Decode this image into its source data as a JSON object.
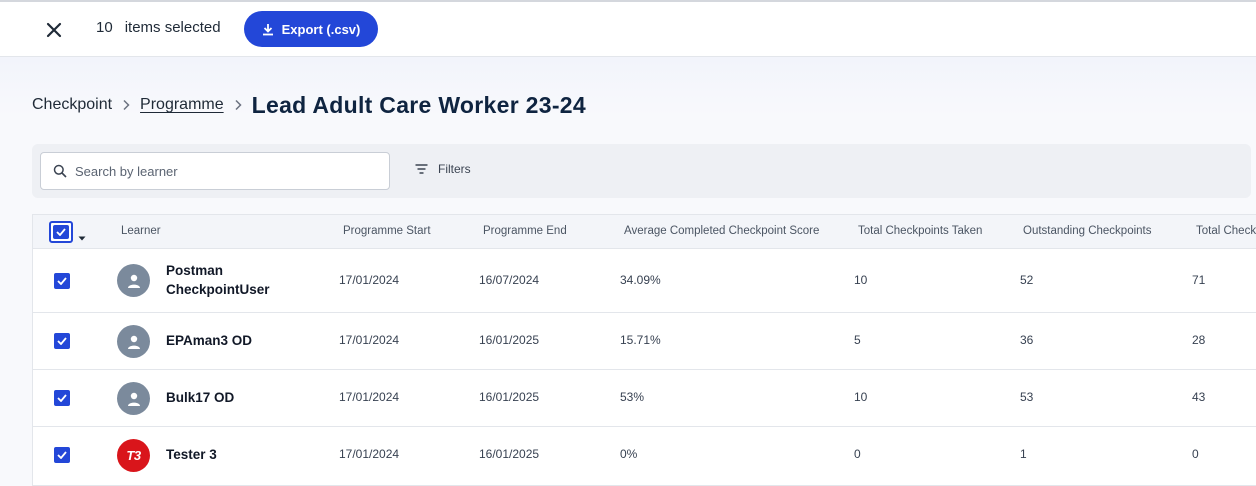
{
  "topbar": {
    "count": "10",
    "selected_label": "items selected",
    "export_label": "Export (.csv)"
  },
  "breadcrumb": {
    "root": "Checkpoint",
    "programme": "Programme",
    "title": "Lead Adult Care Worker 23-24"
  },
  "search": {
    "placeholder": "Search by learner",
    "value": ""
  },
  "filters": {
    "label": "Filters"
  },
  "table": {
    "columns": [
      "Learner",
      "Programme Start",
      "Programme End",
      "Average Completed Checkpoint Score",
      "Total Checkpoints Taken",
      "Outstanding Checkpoints",
      "Total Checkpoints"
    ],
    "rows": [
      {
        "name_line1": "Postman",
        "name_line2": "CheckpointUser",
        "start": "17/01/2024",
        "end": "16/07/2024",
        "avg": "34.09%",
        "taken": "10",
        "outstanding": "52",
        "total": "71",
        "avatar": "user-icon",
        "checked": true
      },
      {
        "name_line1": "EPAman3 OD",
        "name_line2": "",
        "start": "17/01/2024",
        "end": "16/01/2025",
        "avg": "15.71%",
        "taken": "5",
        "outstanding": "36",
        "total": "28",
        "avatar": "user-icon",
        "checked": true
      },
      {
        "name_line1": "Bulk17 OD",
        "name_line2": "",
        "start": "17/01/2024",
        "end": "16/01/2025",
        "avg": "53%",
        "taken": "10",
        "outstanding": "53",
        "total": "43",
        "avatar": "user-icon",
        "checked": true
      },
      {
        "name_line1": "Tester 3",
        "name_line2": "",
        "start": "17/01/2024",
        "end": "16/01/2025",
        "avg": "0%",
        "taken": "0",
        "outstanding": "1",
        "total": "0",
        "avatar": "T3",
        "checked": true
      }
    ]
  },
  "colors": {
    "accent": "#2347d8",
    "title": "#0f2440",
    "avatar_bg": "#7b8a9c",
    "logo_red": "#d9151b"
  }
}
